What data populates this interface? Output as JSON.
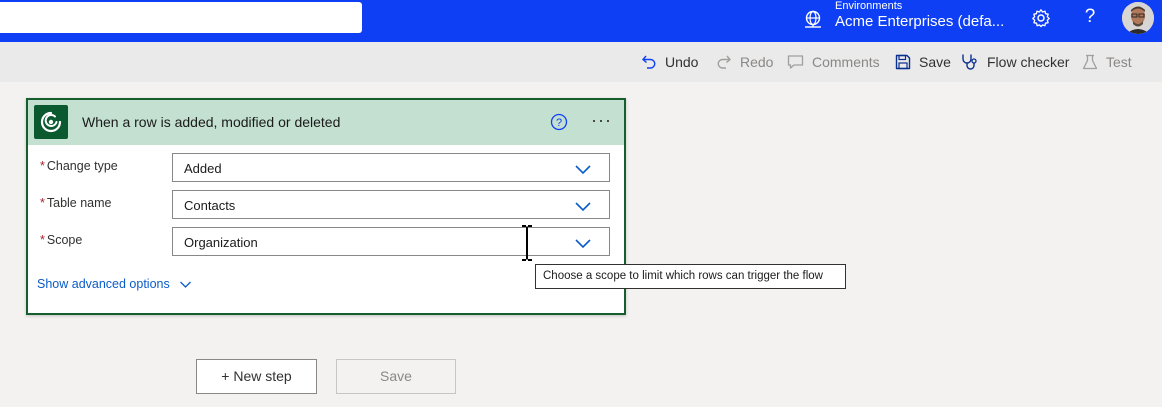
{
  "header": {
    "environment_caption": "Environments",
    "environment_name": "Acme Enterprises (defa...",
    "help_glyph": "?",
    "accent_color": "#0f3ff5"
  },
  "commands": {
    "undo": "Undo",
    "redo": "Redo",
    "comments": "Comments",
    "save": "Save",
    "flow_checker": "Flow checker",
    "test": "Test"
  },
  "trigger": {
    "title": "When a row is added, modified or deleted",
    "more_glyph": "···",
    "header_color": "#c3e0d1",
    "fields": [
      {
        "label": "Change type",
        "value": "Added",
        "required": "*"
      },
      {
        "label": "Table name",
        "value": "Contacts",
        "required": "*"
      },
      {
        "label": "Scope",
        "value": "Organization",
        "required": "*"
      }
    ],
    "advanced_label": "Show advanced options"
  },
  "tooltip": {
    "text": "Choose a scope to limit which rows can trigger the flow"
  },
  "footer": {
    "new_step": "+ New step",
    "save": "Save"
  },
  "icons": [
    "environment-icon",
    "gear-icon",
    "help-icon",
    "avatar",
    "undo-icon",
    "redo-icon",
    "comments-icon",
    "save-icon",
    "flow-checker-icon",
    "test-icon",
    "dataverse-icon",
    "info-icon",
    "more-icon",
    "chevron-down-icon"
  ]
}
